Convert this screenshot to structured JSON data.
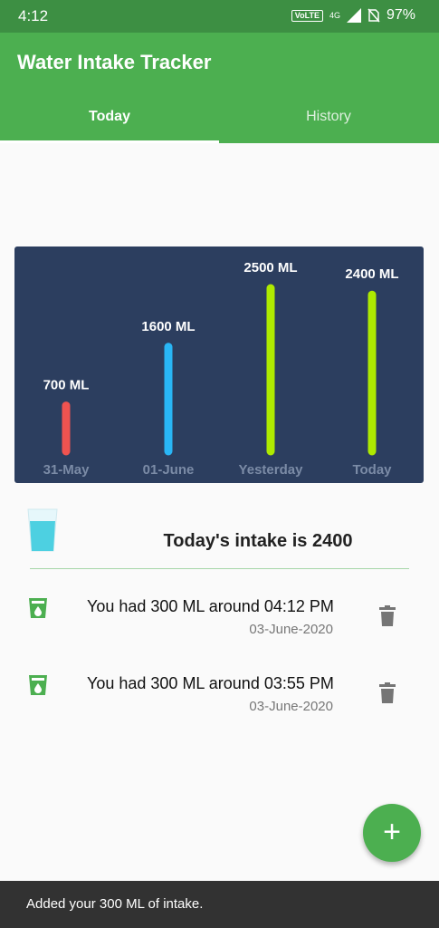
{
  "status_bar": {
    "time": "4:12",
    "volte": "VoLTE",
    "network": "4G",
    "battery": "97%"
  },
  "app": {
    "title": "Water Intake Tracker",
    "tabs": [
      {
        "label": "Today",
        "selected": true
      },
      {
        "label": "History",
        "selected": false
      }
    ]
  },
  "chart_data": {
    "type": "bar",
    "categories": [
      "31-May",
      "01-June",
      "Yesterday",
      "Today"
    ],
    "values": [
      700,
      1600,
      2500,
      2400
    ],
    "value_labels": [
      "700 ML",
      "1600 ML",
      "2500 ML",
      "2400 ML"
    ],
    "colors": [
      "#ef5350",
      "#29b6f6",
      "#aeea00",
      "#aeea00"
    ],
    "ylim": [
      0,
      2500
    ],
    "background": "#2c3e5f"
  },
  "summary": {
    "text": "Today's intake is 2400",
    "icon": "water-glass-icon"
  },
  "log": [
    {
      "message": "You had 300 ML around 04:12 PM",
      "date": "03-June-2020"
    },
    {
      "message": "You had 300 ML around 03:55 PM",
      "date": "03-June-2020"
    }
  ],
  "fab": {
    "label": "+"
  },
  "snackbar": {
    "text": "Added your 300 ML of intake."
  },
  "colors": {
    "primary": "#4caf50",
    "primary_dark": "#3d8f43",
    "chart_bg": "#2c3e5f"
  }
}
